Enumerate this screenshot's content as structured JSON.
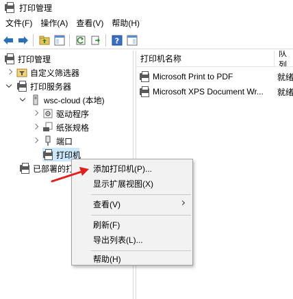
{
  "window": {
    "title": "打印管理"
  },
  "menubar": [
    {
      "label": "文件(F)"
    },
    {
      "label": "操作(A)"
    },
    {
      "label": "查看(V)"
    },
    {
      "label": "帮助(H)"
    }
  ],
  "toolbar": {
    "icons": [
      "back-arrow-icon",
      "forward-arrow-icon",
      "up-folder-icon",
      "show-hide-tree-icon",
      "refresh-icon",
      "export-list-icon",
      "help-icon",
      "properties-pane-icon"
    ]
  },
  "tree": {
    "root": "打印管理",
    "custom_filters": "自定义筛选器",
    "print_servers": "打印服务器",
    "server": "wsc-cloud (本地)",
    "drivers": "驱动程序",
    "forms": "纸张规格",
    "ports": "端口",
    "printers": "打印机",
    "deployed": "已部署的打印机"
  },
  "list": {
    "columns": [
      "打印机名称",
      "队列"
    ],
    "rows": [
      {
        "name": "Microsoft Print to PDF",
        "status": "就绪"
      },
      {
        "name": "Microsoft XPS Document Wr...",
        "status": "就绪"
      }
    ]
  },
  "context_menu": {
    "add_printer": "添加打印机(P)...",
    "show_extended": "显示扩展视图(X)",
    "view": "查看(V)",
    "refresh": "刷新(F)",
    "export": "导出列表(L)...",
    "help": "帮助(H)"
  },
  "colors": {
    "selection": "#cce8ff",
    "annotation_arrow": "#e02020"
  }
}
